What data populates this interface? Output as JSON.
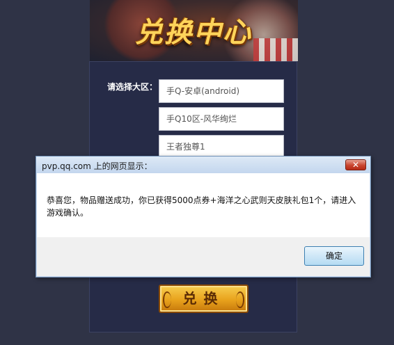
{
  "banner": {
    "title": "兑换中心"
  },
  "form": {
    "region_label": "请选择大区：",
    "platform_value": "手Q-安卓(android)",
    "server_value": "手Q10区-风华绚烂",
    "role_value": "王者独尊1"
  },
  "exchange_button": {
    "label": "兑换"
  },
  "dialog": {
    "title": "pvp.qq.com 上的网页显示：",
    "close_label": "✕",
    "message": "恭喜您，物品赠送成功，你已获得5000点券+海洋之心武则天皮肤礼包1个，请进入游戏确认。",
    "ok_label": "确定"
  },
  "colors": {
    "page_bg": "#2f3346",
    "panel_bg": "#262b47",
    "button_gold": "#e8a21c",
    "dialog_close_red": "#c9452f"
  }
}
